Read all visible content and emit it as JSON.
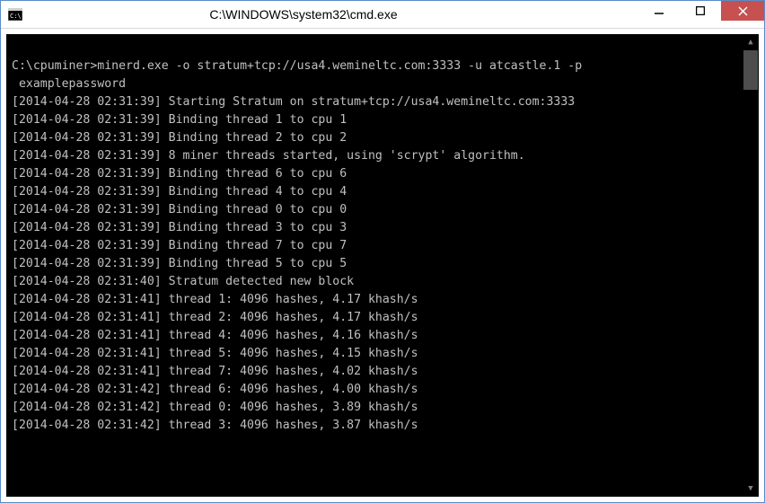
{
  "window": {
    "title": "C:\\WINDOWS\\system32\\cmd.exe"
  },
  "console": {
    "prompt_line1": "C:\\cpuminer>minerd.exe -o stratum+tcp://usa4.wemineltc.com:3333 -u atcastle.1 -p",
    "prompt_line2": " examplepassword",
    "lines": [
      "[2014-04-28 02:31:39] Starting Stratum on stratum+tcp://usa4.wemineltc.com:3333",
      "[2014-04-28 02:31:39] Binding thread 1 to cpu 1",
      "[2014-04-28 02:31:39] Binding thread 2 to cpu 2",
      "[2014-04-28 02:31:39] 8 miner threads started, using 'scrypt' algorithm.",
      "[2014-04-28 02:31:39] Binding thread 6 to cpu 6",
      "[2014-04-28 02:31:39] Binding thread 4 to cpu 4",
      "[2014-04-28 02:31:39] Binding thread 0 to cpu 0",
      "[2014-04-28 02:31:39] Binding thread 3 to cpu 3",
      "[2014-04-28 02:31:39] Binding thread 7 to cpu 7",
      "[2014-04-28 02:31:39] Binding thread 5 to cpu 5",
      "[2014-04-28 02:31:40] Stratum detected new block",
      "[2014-04-28 02:31:41] thread 1: 4096 hashes, 4.17 khash/s",
      "[2014-04-28 02:31:41] thread 2: 4096 hashes, 4.17 khash/s",
      "[2014-04-28 02:31:41] thread 4: 4096 hashes, 4.16 khash/s",
      "[2014-04-28 02:31:41] thread 5: 4096 hashes, 4.15 khash/s",
      "[2014-04-28 02:31:41] thread 7: 4096 hashes, 4.02 khash/s",
      "[2014-04-28 02:31:42] thread 6: 4096 hashes, 4.00 khash/s",
      "[2014-04-28 02:31:42] thread 0: 4096 hashes, 3.89 khash/s",
      "[2014-04-28 02:31:42] thread 3: 4096 hashes, 3.87 khash/s"
    ]
  }
}
